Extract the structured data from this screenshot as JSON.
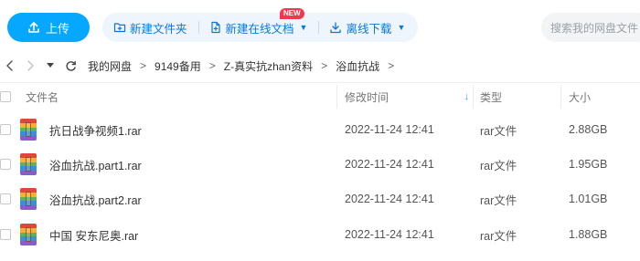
{
  "toolbar": {
    "upload_label": "上传",
    "actions": [
      {
        "label": "新建文件夹",
        "icon": "new-folder-icon",
        "caret": false
      },
      {
        "label": "新建在线文档",
        "icon": "new-doc-icon",
        "caret": true
      },
      {
        "label": "离线下载",
        "icon": "offline-download-icon",
        "caret": true
      }
    ],
    "new_badge": "NEW",
    "search_placeholder": "搜索我的网盘文件"
  },
  "breadcrumb": [
    "我的网盘",
    "9149备用",
    "Z-真实抗zhan资料",
    "浴血抗战"
  ],
  "table": {
    "headers": {
      "name": "文件名",
      "modified": "修改时间",
      "type": "类型",
      "size": "大小"
    },
    "rows": [
      {
        "name": "抗日战争视频1.rar",
        "modified": "2022-11-24 12:41",
        "type": "rar文件",
        "size": "2.88GB"
      },
      {
        "name": "浴血抗战.part1.rar",
        "modified": "2022-11-24 12:41",
        "type": "rar文件",
        "size": "1.95GB"
      },
      {
        "name": "浴血抗战.part2.rar",
        "modified": "2022-11-24 12:41",
        "type": "rar文件",
        "size": "1.01GB"
      },
      {
        "name": "中国 安东尼奥.rar",
        "modified": "2022-11-24 12:41",
        "type": "rar文件",
        "size": "1.88GB"
      }
    ]
  },
  "colors": {
    "accent": "#06a7ff",
    "action_text": "#0a78d6",
    "action_bg": "#eef5fd",
    "badge": "#f5364c",
    "rar_bands": [
      "#e0473c",
      "#f2b233",
      "#5db35a",
      "#3b8fd9",
      "#8a5cc8"
    ]
  }
}
